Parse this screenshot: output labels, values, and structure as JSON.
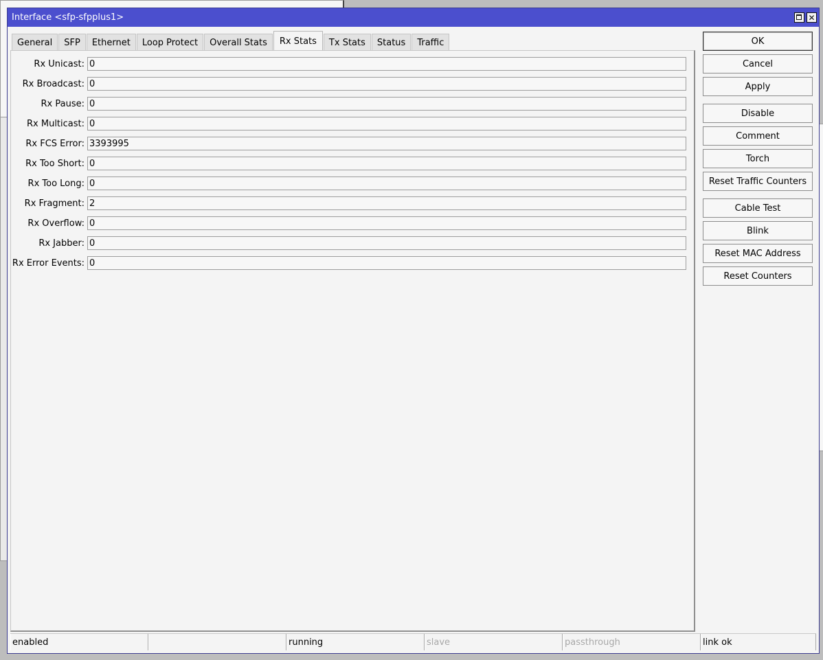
{
  "window": {
    "title": "Interface <sfp-sfpplus1>"
  },
  "tabs": [
    {
      "label": "General"
    },
    {
      "label": "SFP"
    },
    {
      "label": "Ethernet"
    },
    {
      "label": "Loop Protect"
    },
    {
      "label": "Overall Stats"
    },
    {
      "label": "Rx Stats",
      "active": true
    },
    {
      "label": "Tx Stats"
    },
    {
      "label": "Status"
    },
    {
      "label": "Traffic"
    }
  ],
  "fields": [
    {
      "label": "Rx Unicast:",
      "value": "0"
    },
    {
      "label": "Rx Broadcast:",
      "value": "0"
    },
    {
      "label": "Rx Pause:",
      "value": "0"
    },
    {
      "label": "Rx Multicast:",
      "value": "0"
    },
    {
      "label": "Rx FCS Error:",
      "value": "3393995"
    },
    {
      "label": "Rx Too Short:",
      "value": "0"
    },
    {
      "label": "Rx Too Long:",
      "value": "0"
    },
    {
      "label": "Rx Fragment:",
      "value": "2"
    },
    {
      "label": "Rx Overflow:",
      "value": "0"
    },
    {
      "label": "Rx Jabber:",
      "value": "0"
    },
    {
      "label": "Rx Error Events:",
      "value": "0"
    }
  ],
  "buttons": [
    {
      "label": "OK"
    },
    {
      "label": "Cancel"
    },
    {
      "label": "Apply"
    },
    {
      "label": "Disable"
    },
    {
      "label": "Comment"
    },
    {
      "label": "Torch"
    },
    {
      "label": "Reset Traffic Counters"
    },
    {
      "label": "Cable Test"
    },
    {
      "label": "Blink"
    },
    {
      "label": "Reset MAC Address"
    },
    {
      "label": "Reset Counters"
    }
  ],
  "status": [
    {
      "text": "enabled"
    },
    {
      "text": ""
    },
    {
      "text": "running"
    },
    {
      "text": "slave",
      "dim": true
    },
    {
      "text": "passthrough",
      "dim": true
    },
    {
      "text": "link ok"
    }
  ],
  "colors": {
    "titlebar": "#4b4fce",
    "window_bg": "#f4f4f4",
    "dim_text": "#a8a8a8"
  }
}
